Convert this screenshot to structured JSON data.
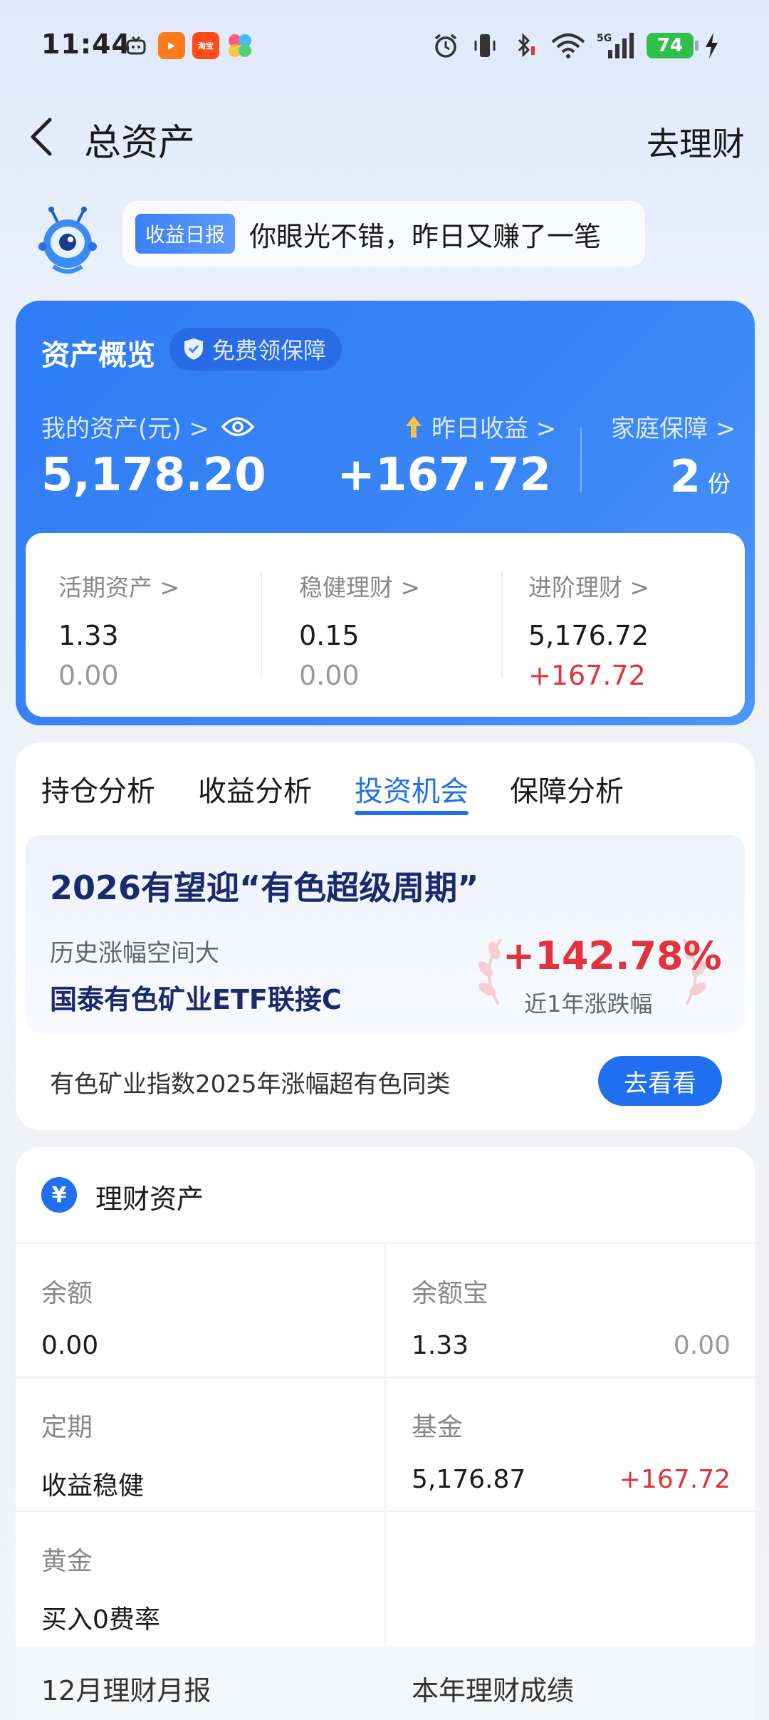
{
  "status_bar": {
    "time": "11:44",
    "battery": "74",
    "network": "5G",
    "app_icons": [
      "tv-icon",
      "video-app-icon",
      "taobao-app-icon",
      "pinwheel-app-icon"
    ],
    "system_icons": [
      "alarm-icon",
      "vibrate-icon",
      "bluetooth-icon",
      "wifi-icon",
      "signal-icon",
      "charging-icon"
    ]
  },
  "header": {
    "title": "总资产",
    "action": "去理财"
  },
  "daily_report": {
    "tag": "收益日报",
    "text": "你眼光不错，昨日又赚了一笔"
  },
  "asset_overview": {
    "title": "资产概览",
    "badge": "免费领保障",
    "my_asset_label": "我的资产(元) >",
    "my_asset_value": "5,178.20",
    "yesterday_label": "昨日收益 >",
    "yesterday_value": "+167.72",
    "family_label": "家庭保障 >",
    "family_value": "2",
    "family_unit": "份",
    "sub": [
      {
        "label": "活期资产 >",
        "v1": "1.33",
        "v2": "0.00",
        "v2_positive": false
      },
      {
        "label": "稳健理财 >",
        "v1": "0.15",
        "v2": "0.00",
        "v2_positive": false
      },
      {
        "label": "进阶理财 >",
        "v1": "5,176.72",
        "v2": "+167.72",
        "v2_positive": true
      }
    ]
  },
  "tabs": {
    "items": [
      "持仓分析",
      "收益分析",
      "投资机会",
      "保障分析"
    ],
    "active": "投资机会"
  },
  "promo": {
    "title": "2026有望迎“有色超级周期”",
    "subtitle": "历史涨幅空间大",
    "fund": "国泰有色矿业ETF联接C",
    "percent": "+142.78%",
    "percent_label": "近1年涨跌幅",
    "note": "有色矿业指数2025年涨幅超有色同类",
    "button": "去看看"
  },
  "wealth": {
    "title": "理财资产",
    "cells": [
      {
        "label": "余额",
        "value": "0.00",
        "right": ""
      },
      {
        "label": "余额宝",
        "value": "1.33",
        "right": "0.00"
      },
      {
        "label": "定期",
        "value": "收益稳健",
        "right": ""
      },
      {
        "label": "基金",
        "value": "5,176.87",
        "right": "+167.72"
      },
      {
        "label": "黄金",
        "value": "买入0费率",
        "right": ""
      }
    ],
    "footer_left": "12月理财月报",
    "footer_right": "本年理财成绩"
  },
  "colors": {
    "primary": "#1f6ff0",
    "card_blue": "#3a86f7",
    "gain_red": "#e0333a",
    "text_dark": "#1a1a1a",
    "text_gray": "#888888"
  }
}
